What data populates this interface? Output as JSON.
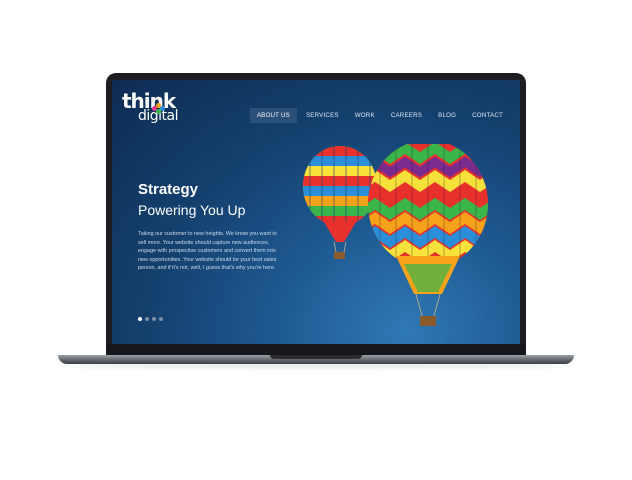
{
  "brand": {
    "line1": "think",
    "line2": "digital"
  },
  "nav": {
    "items": [
      {
        "label": "ABOUT US",
        "active": true
      },
      {
        "label": "SERVICES",
        "active": false
      },
      {
        "label": "WORK",
        "active": false
      },
      {
        "label": "CAREERS",
        "active": false
      },
      {
        "label": "BLOG",
        "active": false
      },
      {
        "label": "CONTACT",
        "active": false
      }
    ]
  },
  "hero": {
    "title": "Strategy",
    "subtitle": "Powering You Up",
    "body_lines": [
      "Taking our customer to new heights.  We know you want to",
      "sell more. Your website should capture new audiences,",
      "engage with prospective customers and convert them into",
      "new opportunities. Your website should be your best sales",
      "person, and if it's not, well, I guess that's why you're here."
    ]
  },
  "pager": {
    "count": 4,
    "active_index": 0
  },
  "colors": {
    "nav_active_bg": "#2a4f78",
    "screen_top": "#0d2c52",
    "screen_glow": "#2f79b4",
    "logo_dots": [
      "#e63a8f",
      "#f6a21a",
      "#39b54a",
      "#2a8fd8"
    ]
  },
  "images": {
    "hero_image": "hot-air-balloons"
  }
}
